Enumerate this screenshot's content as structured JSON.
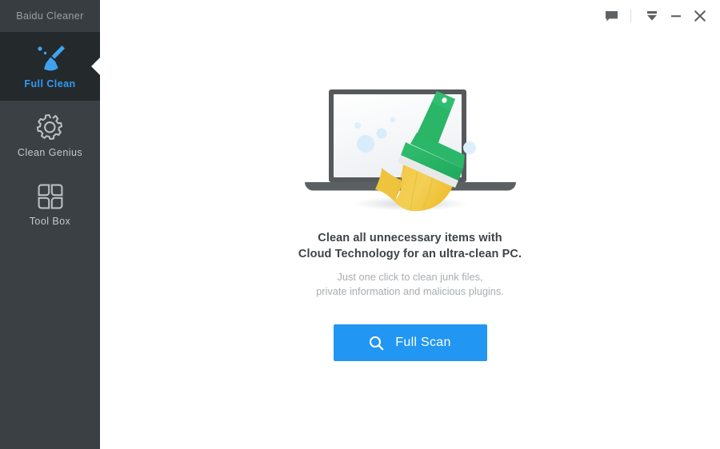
{
  "app": {
    "brand": "Baidu Cleaner",
    "accent_color": "#2196f3",
    "sidebar_bg": "#3a4043",
    "sidebar_active_bg": "#24292c",
    "header_bg": "#373d40"
  },
  "sidebar": {
    "items": [
      {
        "id": "full-clean",
        "label": "Full Clean",
        "icon": "broom-icon",
        "active": true
      },
      {
        "id": "clean-genius",
        "label": "Clean Genius",
        "icon": "gear-icon",
        "active": false
      },
      {
        "id": "tool-box",
        "label": "Tool Box",
        "icon": "grid-icon",
        "active": false
      }
    ]
  },
  "titlebar": {
    "buttons": [
      {
        "id": "feedback",
        "icon": "speech-bubble-icon",
        "title": "Feedback"
      },
      {
        "id": "tray",
        "icon": "minimize-to-tray-icon",
        "title": "Minimize to tray"
      },
      {
        "id": "minimize",
        "icon": "minimize-icon",
        "title": "Minimize"
      },
      {
        "id": "close",
        "icon": "close-icon",
        "title": "Close"
      }
    ]
  },
  "main": {
    "illustration": "laptop-with-brush-illustration",
    "headline_line1": "Clean all unnecessary items with",
    "headline_line2": "Cloud Technology for an ultra-clean PC.",
    "subline_line1": "Just one click to clean junk files,",
    "subline_line2": "private information and malicious plugins.",
    "scan_button_label": "Full Scan",
    "scan_button_icon": "search-icon"
  }
}
